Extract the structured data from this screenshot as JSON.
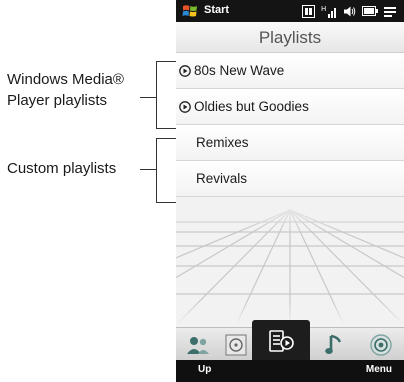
{
  "callouts": {
    "wmp_line1": "Windows Media®",
    "wmp_line2": "Player playlists",
    "custom": "Custom playlists"
  },
  "status_bar": {
    "start_label": "Start"
  },
  "screen": {
    "title": "Playlists"
  },
  "playlists": {
    "wmp": [
      {
        "label": "80s New Wave",
        "icon": "play-circle-icon"
      },
      {
        "label": "Oldies but Goodies",
        "icon": "play-circle-icon"
      }
    ],
    "custom": [
      {
        "label": "Remixes"
      },
      {
        "label": "Revivals"
      }
    ]
  },
  "tabs": [
    {
      "icon": "people-icon",
      "selected": false
    },
    {
      "icon": "album-icon",
      "selected": false
    },
    {
      "icon": "playlist-icon",
      "selected": true
    },
    {
      "icon": "music-note-icon",
      "selected": false
    },
    {
      "icon": "speaker-icon",
      "selected": false
    }
  ],
  "softkeys": {
    "left": "Up",
    "right": "Menu"
  },
  "colors": {
    "status_bar": "#141414",
    "selected_tab": "#1d1d1d",
    "screen_bg": "#f2f2f2"
  }
}
